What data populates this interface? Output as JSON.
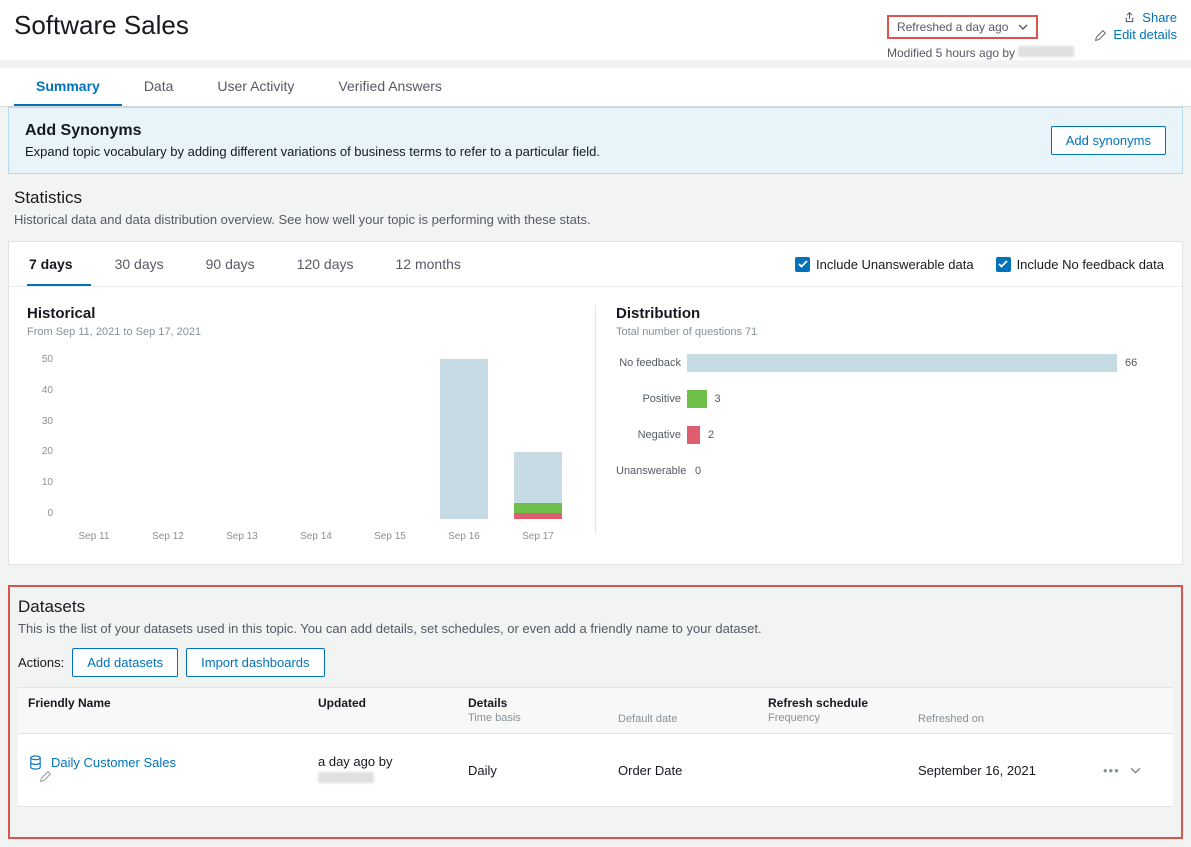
{
  "page_title": "Software Sales",
  "refresh_label": "Refreshed a day ago",
  "modified_label": "Modified 5 hours ago by",
  "header_actions": {
    "share": "Share",
    "edit": "Edit details"
  },
  "tabs": [
    "Summary",
    "Data",
    "User Activity",
    "Verified Answers"
  ],
  "active_tab": 0,
  "banner": {
    "title": "Add Synonyms",
    "desc": "Expand topic vocabulary by adding different variations of business terms to refer to a particular field.",
    "button": "Add synonyms"
  },
  "statistics": {
    "title": "Statistics",
    "desc": "Historical data and data distribution overview. See how well your topic is performing with these stats."
  },
  "range_tabs": [
    "7 days",
    "30 days",
    "90 days",
    "120 days",
    "12 months"
  ],
  "active_range": 0,
  "checkboxes": {
    "unanswerable": "Include Unanswerable data",
    "nofeedback": "Include No feedback data"
  },
  "historical": {
    "title": "Historical",
    "sub": "From Sep 11, 2021 to Sep 17, 2021"
  },
  "distribution": {
    "title": "Distribution",
    "sub": "Total number of questions 71",
    "rows": [
      {
        "label": "No feedback",
        "value": 66,
        "color": "#c7dbe5"
      },
      {
        "label": "Positive",
        "value": 3,
        "color": "#6fbf4b"
      },
      {
        "label": "Negative",
        "value": 2,
        "color": "#e05d6f"
      },
      {
        "label": "Unanswerable",
        "value": 0,
        "color": "#999"
      }
    ]
  },
  "chart_data": {
    "type": "bar",
    "categories": [
      "Sep 11",
      "Sep 12",
      "Sep 13",
      "Sep 14",
      "Sep 15",
      "Sep 16",
      "Sep 17"
    ],
    "series": [
      {
        "name": "No feedback",
        "color": "#c7dbe5",
        "values": [
          0,
          0,
          0,
          0,
          0,
          50,
          16
        ]
      },
      {
        "name": "Positive",
        "color": "#6fbf4b",
        "values": [
          0,
          0,
          0,
          0,
          0,
          0,
          3
        ]
      },
      {
        "name": "Negative",
        "color": "#e05d6f",
        "values": [
          0,
          0,
          0,
          0,
          0,
          0,
          2
        ]
      }
    ],
    "ylim": [
      0,
      50
    ],
    "yticks": [
      0,
      10,
      20,
      30,
      40,
      50
    ],
    "title": "Historical",
    "xlabel": "",
    "ylabel": ""
  },
  "datasets": {
    "title": "Datasets",
    "desc": "This is the list of your datasets used in this topic. You can add details, set schedules, or even add a friendly name to your dataset.",
    "actions_label": "Actions:",
    "add_btn": "Add datasets",
    "import_btn": "Import dashboards",
    "columns": {
      "name": "Friendly Name",
      "updated": "Updated",
      "details": "Details",
      "details_sub": "Time basis",
      "default_date": "Default date",
      "refresh_sched": "Refresh schedule",
      "refresh_sched_sub": "Frequency",
      "refreshed_on": "Refreshed on"
    },
    "rows": [
      {
        "name": "Daily Customer Sales",
        "updated": "a day ago by",
        "details": "Daily",
        "default_date": "Order Date",
        "frequency": "",
        "refreshed_on": "September 16, 2021"
      }
    ]
  }
}
